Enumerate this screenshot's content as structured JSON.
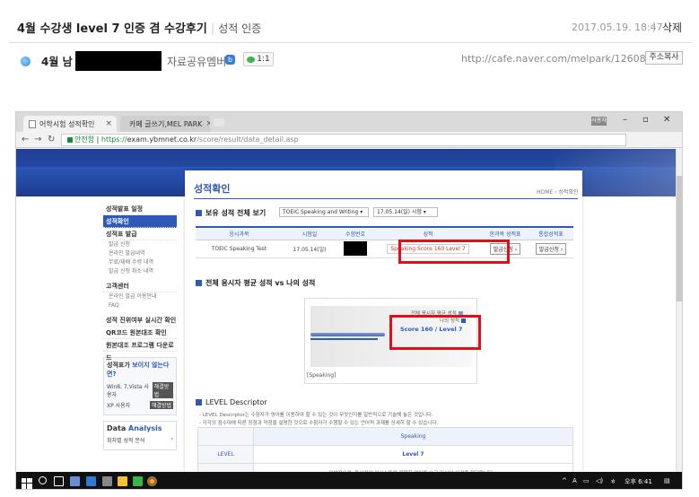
{
  "post": {
    "title": "4월 수강생 level 7 인증 겸 수강후기",
    "category": "성적 인증",
    "date": "2017.05.19. 18:47",
    "delete_label": "삭제",
    "author_prefix": "4월 남",
    "author_role": "자료공유멤버",
    "author_badge": "b",
    "comment_count": "1:1",
    "url": "http://cafe.naver.com/melpark/12608",
    "copy_url_label": "주소복사"
  },
  "browser": {
    "tabs": [
      {
        "label": "어학시험 성적확인"
      },
      {
        "label": "카페 글쓰기,MEL PARK"
      }
    ],
    "tab_close": "×",
    "user_label": "사용자",
    "address": {
      "secure_label": "안전함",
      "scheme": "https://",
      "host": "exam.ybmnet.co.kr",
      "path": "/score/result/data_detail.asp"
    }
  },
  "site": {
    "sidebar": {
      "items": [
        {
          "label": "성적발표 일정"
        },
        {
          "label": "성적확인"
        },
        {
          "label": "성적표 발급"
        }
      ],
      "sub_items": [
        "발급 신청",
        "온라인 발급내역",
        "무료/재배 수령 내역",
        "발급 신청 취소 내역"
      ],
      "cs_title": "고객센터",
      "cs_items": [
        "온라인 발급 이용안내",
        "FAQ"
      ],
      "links": [
        "성적 진위여부 실시간 확인",
        "QR코드 원본대조 확인",
        "원본대조 프로그램 다운로드"
      ],
      "promo_title_prefix": "성적표가 ",
      "promo_title_highlight": "보이지 않는다면?",
      "promo_rows": [
        {
          "label": "Win8, 7,Vista 사용자",
          "tag": "해결방법"
        },
        {
          "label": "XP 사용자",
          "tag": "해결방법"
        }
      ],
      "analysis_title_1": "Data ",
      "analysis_title_2": "Analysis",
      "analysis_rows": [
        "회차별 성적 분석"
      ]
    },
    "page_title": "성적확인",
    "breadcrumb": "HOME › 성적확인",
    "section1": {
      "title": "보유 성적 전체 보기",
      "select_test": "TOEIC Speaking and Writing",
      "select_date": "17.05.14(일) 시험"
    },
    "table": {
      "headers": [
        "응시과목",
        "시험일",
        "수험번호",
        "성적",
        "한과목 성적표",
        "통합성적표"
      ],
      "row": {
        "subject": "TOEIC Speaking Test",
        "date": "17.05.14(일)",
        "score": "Speaking Score 160 Level 7",
        "btn1": "발급신청 ›",
        "btn2": "발급신청 ›"
      }
    },
    "section2": {
      "title": "전체 응시자 평균 성적 vs 나의 성적",
      "legend_avg": "전체 응시자 평균 성적",
      "legend_me": "나의 성적",
      "score_label": "Score 160 / Level 7",
      "axis_label": "[Speaking]"
    },
    "section3": {
      "title": "LEVEL Descriptor",
      "desc1": "- LEVEL Descriptor는 수험자가 영어를 이용하여 할 수 있는 것이 무엇인지를 일반적으로 기술해 놓은 것입니다.",
      "desc2": "- 각각의 점수대에 따른 장점과 약점을 설명한 것으로 수험자가 수행할 수 있는 언어적 과제를 상세히 할 수 있습니다.",
      "col_head": "Speaking",
      "row_label": "LEVEL",
      "level_value": "Level 7",
      "cut_text": "일반적으로, 통상적인 의사소통에 적합한 영어를 쓰고 자신의 의견을 전달합니다..."
    }
  },
  "colors": {
    "accent_blue": "#2e59b7",
    "highlight_red": "#e0101a"
  },
  "chart_data": {
    "type": "bar",
    "categories": [
      "[Speaking]"
    ],
    "series": [
      {
        "name": "전체 응시자 평균 성적",
        "values": [
          140
        ]
      },
      {
        "name": "나의 성적",
        "values": [
          160
        ]
      }
    ],
    "xlim": [
      0,
      200
    ]
  },
  "taskbar": {
    "ime": "A",
    "lang": "ㅎ",
    "time": "오후 6:41"
  }
}
